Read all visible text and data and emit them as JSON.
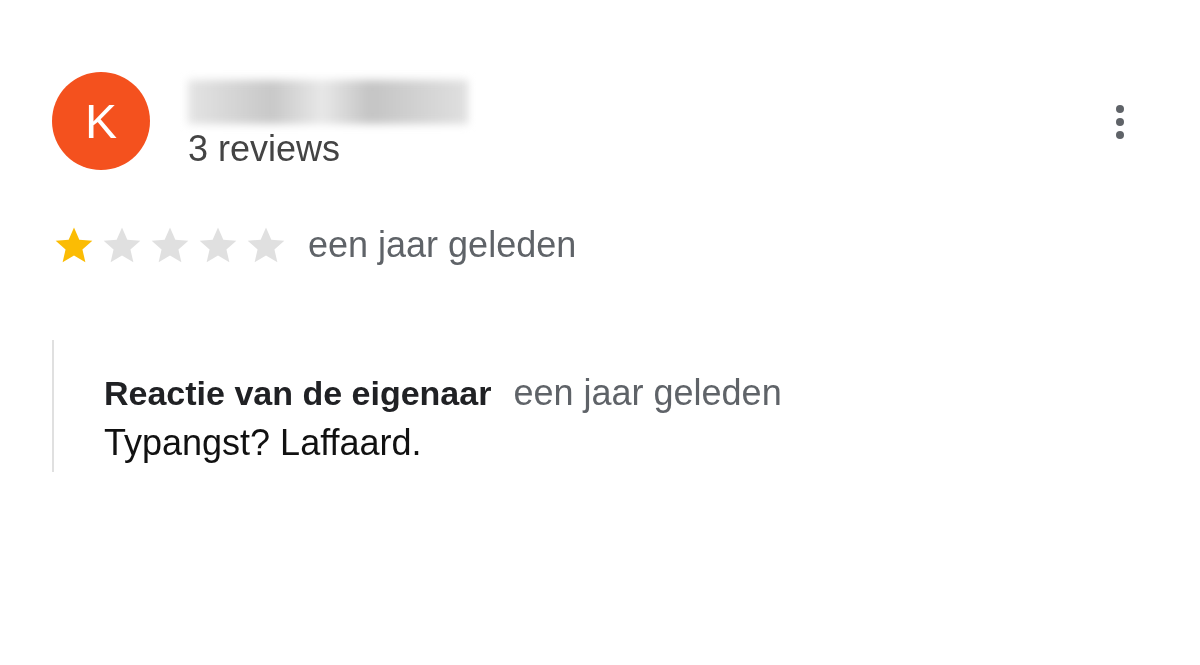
{
  "reviewer": {
    "avatar_letter": "K",
    "review_count": "3 reviews"
  },
  "review": {
    "stars": 1,
    "time": "een jaar geleden"
  },
  "owner_reply": {
    "heading": "Reactie van de eigenaar",
    "time": "een jaar geleden",
    "text": "Typangst? Laffaard."
  }
}
